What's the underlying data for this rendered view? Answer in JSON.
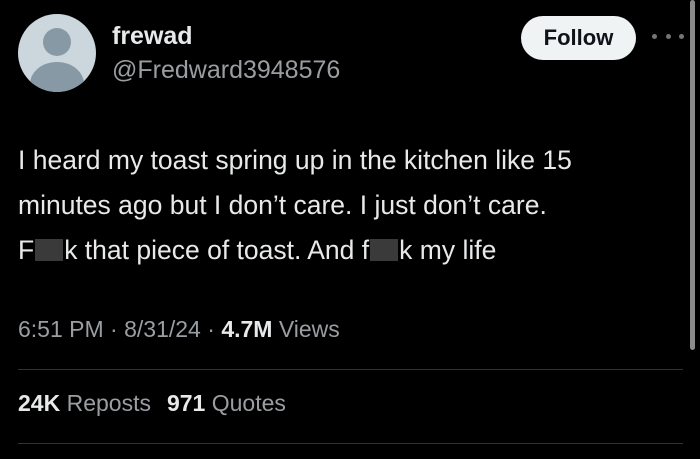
{
  "user": {
    "display_name": "frewad",
    "handle": "@Fredward3948576"
  },
  "actions": {
    "follow_label": "Follow",
    "more_icon": "more-horizontal-icon"
  },
  "tweet": {
    "line1": "I heard my toast spring up in the kitchen like 15",
    "line2": "minutes ago but I don’t care. I just don’t care.",
    "line3_part1": "F",
    "line3_part2": "k that piece of toast. And f",
    "line3_part3": "k my life"
  },
  "meta": {
    "time": "6:51 PM",
    "date": "8/31/24",
    "views_count": "4.7M",
    "views_label": "Views",
    "separator": "·"
  },
  "stats": {
    "reposts_count": "24K",
    "reposts_label": "Reposts",
    "quotes_count": "971",
    "quotes_label": "Quotes"
  },
  "colors": {
    "background": "#000000",
    "text_primary": "#e7e9ea",
    "text_secondary": "#9a9ea3",
    "follow_button_bg": "#eff3f4",
    "divider": "#2f3336"
  }
}
